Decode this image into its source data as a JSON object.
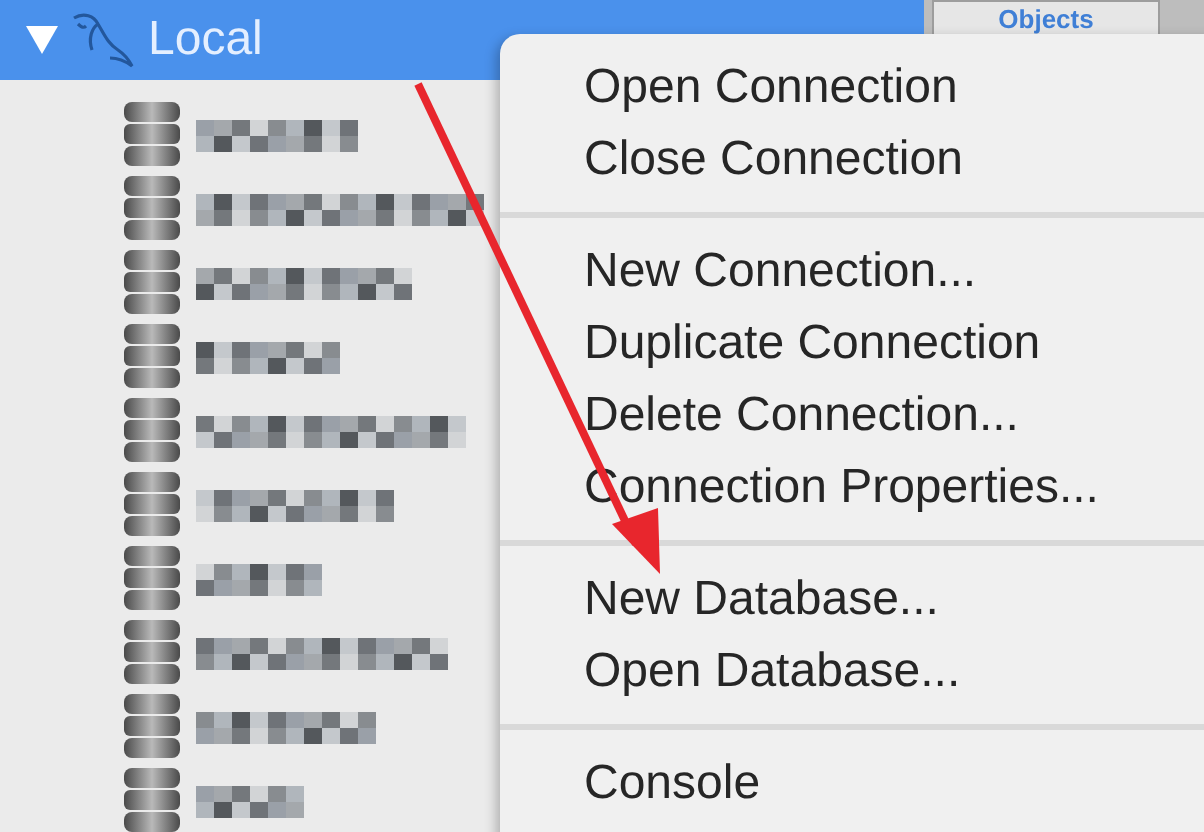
{
  "sidebar": {
    "root": {
      "label": "Local",
      "expanded": true,
      "selected": true
    },
    "items": [
      {
        "kind": "database"
      },
      {
        "kind": "database"
      },
      {
        "kind": "database"
      },
      {
        "kind": "database"
      },
      {
        "kind": "database"
      },
      {
        "kind": "database"
      },
      {
        "kind": "database"
      },
      {
        "kind": "database"
      },
      {
        "kind": "database"
      },
      {
        "kind": "database"
      }
    ]
  },
  "tabs": [
    {
      "label": "Objects",
      "selected": true
    }
  ],
  "context_menu": {
    "groups": [
      [
        "Open Connection",
        "Close Connection"
      ],
      [
        "New Connection...",
        "Duplicate Connection",
        "Delete Connection...",
        "Connection Properties..."
      ],
      [
        "New Database...",
        "Open Database..."
      ],
      [
        "Console"
      ]
    ]
  }
}
